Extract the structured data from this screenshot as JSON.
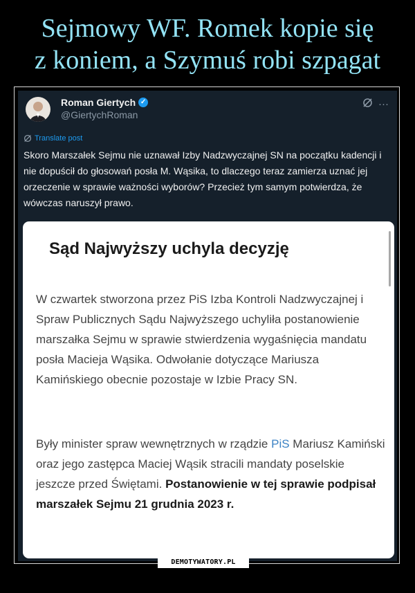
{
  "meme": {
    "title_line1": "Sejmowy WF. Romek kopie się",
    "title_line2": "z koniem, a Szymuś robi szpagat",
    "watermark": "DEMOTYWATORY.PL"
  },
  "tweet": {
    "author_name": "Roman Giertych",
    "verified_icon": "check",
    "handle": "@GiertychRoman",
    "more_icon": "···",
    "translate_label": "Translate post",
    "text": "Skoro Marszałek Sejmu nie uznawał Izby Nadzwyczajnej SN na początku kadencji i nie dopuścił do głosowań posła M. Wąsika, to dlaczego teraz zamierza uznać jej orzeczenie w sprawie ważności wyborów? Przecież tym samym potwierdza, że wówczas naruszył prawo."
  },
  "article": {
    "headline": "Sąd Najwyższy uchyla decyzję",
    "paragraph1": "W czwartek stworzona przez PiS Izba Kontroli Nadzwyczajnej i Spraw Publicznych Sądu Najwyższego uchyliła postanowienie marszałka Sejmu w sprawie stwierdzenia wygaśnięcia mandatu posła Macieja Wąsika. Odwołanie dotyczące Mariusza Kamińskiego obecnie pozostaje w Izbie Pracy SN.",
    "paragraph2_start": "Były minister spraw wewnętrznych w rządzie ",
    "paragraph2_link": "PiS",
    "paragraph2_middle": " Mariusz Kamiński oraz jego zastępca Maciej Wąsik stracili mandaty poselskie jeszcze przed Świętami. ",
    "paragraph2_bold": "Postanowienie w tej sprawie podpisał marszałek Sejmu 21 grudnia 2023 r."
  },
  "colors": {
    "title": "#93e3f5",
    "tweet_bg": "#15202b",
    "verified": "#1d9bf0"
  }
}
